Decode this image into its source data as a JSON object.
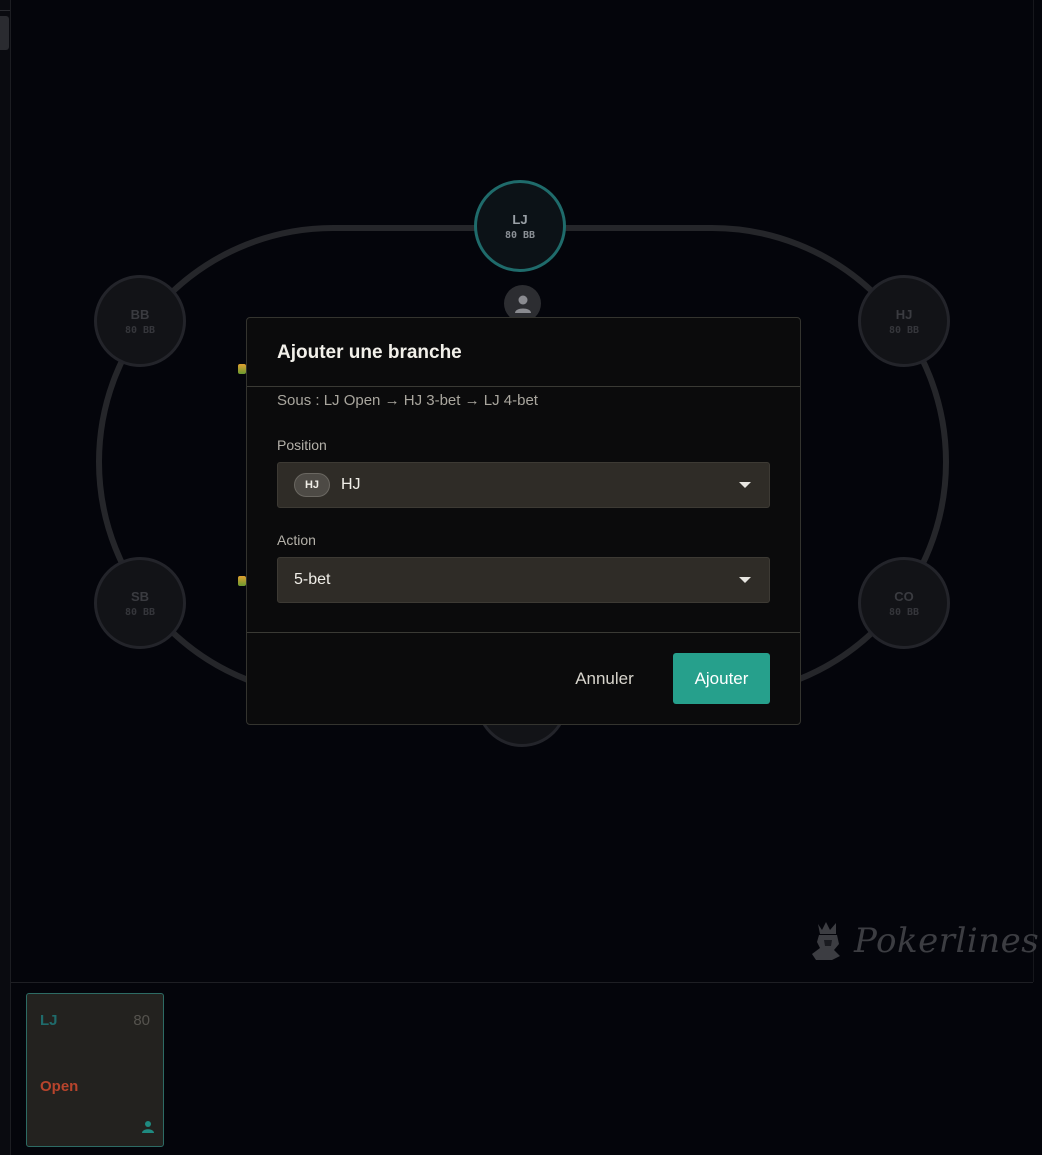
{
  "table": {
    "seats": [
      {
        "pos": "LJ",
        "stack": "80 BB",
        "active": true
      },
      {
        "pos": "BB",
        "stack": "80 BB",
        "active": false
      },
      {
        "pos": "HJ",
        "stack": "80 BB",
        "active": false
      },
      {
        "pos": "SB",
        "stack": "80 BB",
        "active": false
      },
      {
        "pos": "CO",
        "stack": "80 BB",
        "active": false
      }
    ]
  },
  "modal": {
    "title": "Ajouter une branche",
    "breadcrumb": "Sous : LJ Open → HJ 3-bet → LJ 4-bet",
    "position_label": "Position",
    "position_badge": "HJ",
    "position_value": "HJ",
    "action_label": "Action",
    "action_value": "5-bet",
    "cancel_label": "Annuler",
    "add_label": "Ajouter"
  },
  "logo": {
    "text": "Pokerlines"
  },
  "history": {
    "cards": [
      {
        "pos": "LJ",
        "stack": "80",
        "action": "Open"
      }
    ]
  },
  "colors": {
    "accent": "#26a08c",
    "active_seat_ring": "#1f6b6b",
    "open_action": "#b8442c"
  }
}
